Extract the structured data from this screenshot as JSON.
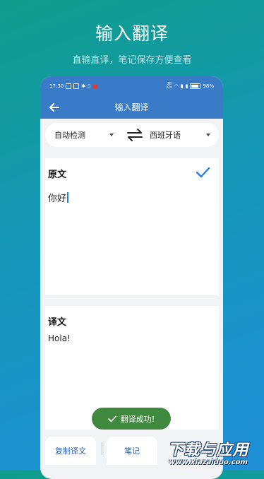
{
  "hero": {
    "title": "输入翻译",
    "subtitle": "直输直译，笔记保存方便查看"
  },
  "status_bar": {
    "time": "17:30",
    "net_speed_top": "28",
    "net_speed_bottom": "K/s",
    "battery": "98%"
  },
  "toolbar": {
    "title": "输入翻译",
    "back_icon": "arrow-left-icon"
  },
  "language_bar": {
    "source": "自动检测",
    "target": "西班牙语",
    "swap_icon": "swap-arrows-icon"
  },
  "source_card": {
    "label": "原文",
    "text": "你好",
    "confirm_icon": "check-icon"
  },
  "target_card": {
    "label": "译文",
    "text": "Hola!"
  },
  "toast": {
    "text": "翻译成功!"
  },
  "bottom_actions": {
    "copy_label": "复制译文",
    "note_label": "笔记"
  },
  "watermark": {
    "main": "下载与应用",
    "url": "www.xiazaiduo.com"
  },
  "colors": {
    "accent": "#3a7bc8",
    "check": "#2a7de1",
    "toast": "#3f8a3f"
  }
}
